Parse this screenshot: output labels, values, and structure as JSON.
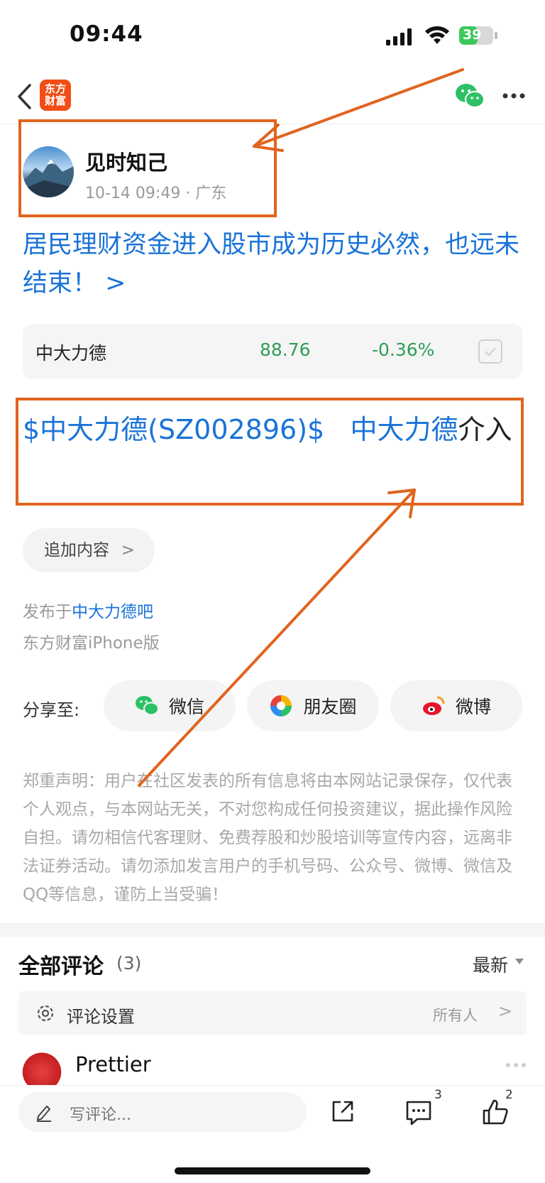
{
  "status_bar": {
    "time": "09:44",
    "battery": "39"
  },
  "nav": {
    "logo_text": "东方财富",
    "accent": "#f04e16"
  },
  "author": {
    "name": "见时知己",
    "meta": "10-14 09:49 · 广东"
  },
  "post": {
    "title": "居民理财资金进入股市成为历史必然，也远未结束！ >",
    "body_tag": "$中大力德(SZ002896)$",
    "body_link": "中大力德",
    "body_text": "介入",
    "link_color": "#1a73d8"
  },
  "stock": {
    "name": "中大力德",
    "price": "88.76",
    "change": "-0.36%",
    "change_color": "#2e9e55"
  },
  "add_content": {
    "label": "追加内容",
    "chevron": ">"
  },
  "published": {
    "prefix": "发布于",
    "bar": "中大力德吧",
    "platform": "东方财富iPhone版"
  },
  "share": {
    "label": "分享至:",
    "options": [
      {
        "label": "微信",
        "icon": "wechat-icon"
      },
      {
        "label": "朋友圈",
        "icon": "moments-icon"
      },
      {
        "label": "微博",
        "icon": "weibo-icon"
      }
    ]
  },
  "disclaimer": "郑重声明：用户在社区发表的所有信息将由本网站记录保存，仅代表个人观点，与本网站无关，不对您构成任何投资建议，据此操作风险自担。请勿相信代客理财、免费荐股和炒股培训等宣传内容，远离非法证券活动。请勿添加发言用户的手机号码、公众号、微博、微信及QQ等信息，谨防上当受骗！",
  "comments": {
    "title": "全部评论",
    "count": "(3)",
    "sort": "最新",
    "settings_label": "评论设置",
    "settings_value": "所有人",
    "settings_chevron": ">",
    "first_commenter": "Prettier"
  },
  "bottom_bar": {
    "write_placeholder": "写评论...",
    "comment_count": "3",
    "like_count": "2"
  },
  "annotation": {
    "color": "#e0641e"
  }
}
